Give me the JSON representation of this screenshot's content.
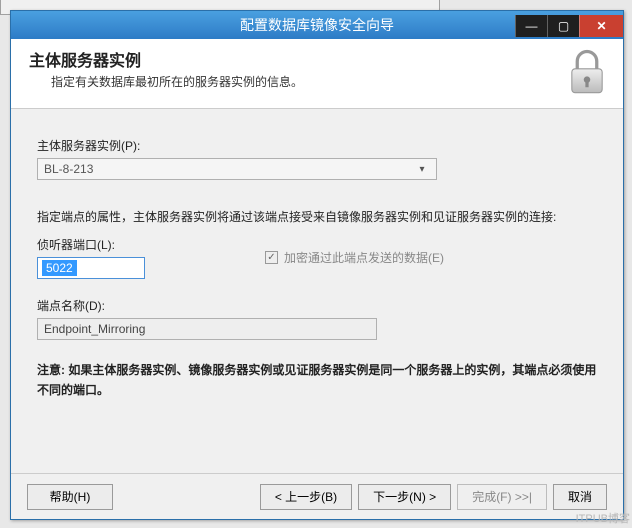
{
  "window": {
    "title": "配置数据库镜像安全向导"
  },
  "header": {
    "title": "主体服务器实例",
    "subtitle": "指定有关数据库最初所在的服务器实例的信息。"
  },
  "body": {
    "principal_label": "主体服务器实例(P):",
    "principal_value": "BL-8-213",
    "endpoint_desc": "指定端点的属性，主体服务器实例将通过该端点接受来自镜像服务器实例和见证服务器实例的连接:",
    "port_label": "侦听器端口(L):",
    "port_value": "5022",
    "encrypt_label": "加密通过此端点发送的数据(E)",
    "endpoint_name_label": "端点名称(D):",
    "endpoint_name_value": "Endpoint_Mirroring",
    "note": "注意: 如果主体服务器实例、镜像服务器实例或见证服务器实例是同一个服务器上的实例，其端点必须使用不同的端口。"
  },
  "footer": {
    "help": "帮助(H)",
    "back": "< 上一步(B)",
    "next": "下一步(N) >",
    "finish": "完成(F) >>|",
    "cancel": "取消"
  },
  "watermark": "ITPUB博客"
}
